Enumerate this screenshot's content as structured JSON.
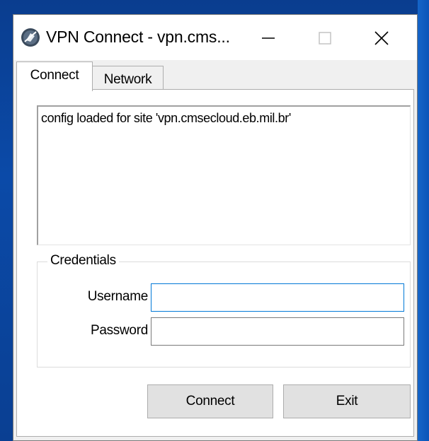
{
  "window": {
    "title": "VPN Connect - vpn.cms...",
    "controls": {
      "minimize": "minimize-icon",
      "maximize": "maximize-icon",
      "close": "close-icon"
    }
  },
  "tabs": [
    {
      "label": "Connect",
      "active": true
    },
    {
      "label": "Network",
      "active": false
    }
  ],
  "log": {
    "lines": [
      "config loaded for site 'vpn.cmsecloud.eb.mil.br'"
    ]
  },
  "credentials": {
    "group_label": "Credentials",
    "username_label": "Username",
    "username_value": "",
    "password_label": "Password",
    "password_value": ""
  },
  "buttons": {
    "connect_label": "Connect",
    "exit_label": "Exit"
  },
  "colors": {
    "focus_border": "#0078d7",
    "button_face": "#e1e1e1",
    "desktop": "#0b4aa8"
  }
}
